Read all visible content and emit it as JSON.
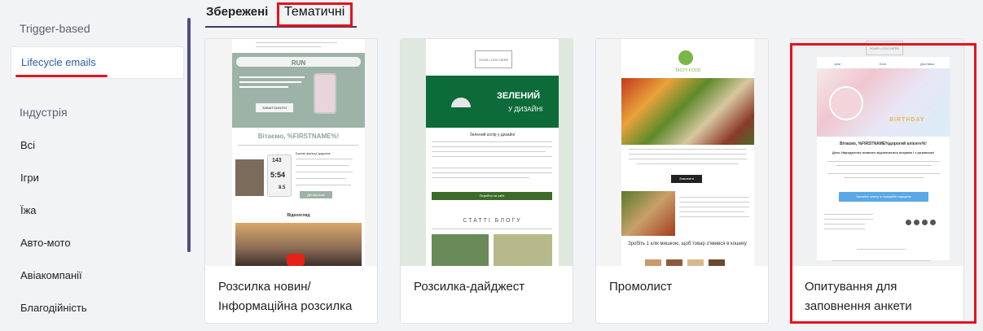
{
  "sidebar": {
    "trigger_label": "Trigger-based",
    "lifecycle_label": "Lifecycle emails",
    "industry_label": "Індустрія",
    "items": [
      "Всі",
      "Ігри",
      "Їжа",
      "Авто-мото",
      "Авіакомпанії",
      "Благодійність"
    ]
  },
  "tabs": {
    "saved": "Збережені",
    "thematic": "Тематичні"
  },
  "cards": [
    {
      "title": "Розсилка новин/ Інформаційна розсилка",
      "thumb": {
        "brand": "RUN",
        "heading": "Вітаємо, %FIRSTNAME%!",
        "button": "ЗАВАНТАЖИТИ",
        "stat1": "143",
        "stat2": "5:54",
        "stat3": "8.5",
        "section": "Відеоогляд",
        "feature_heading": "Базові функції додатка:",
        "more": "Детальніше"
      }
    },
    {
      "title": "Розсилка-дайджест",
      "thumb": {
        "logo": "YOUR LOGO HERE",
        "banner1": "ЗЕЛЕНИЙ",
        "banner2": "У ДИЗАЙНІ",
        "subtitle": "Зелений колір у дизайні",
        "button": "Перейти на сайт",
        "blog": "СТАТТІ БЛОГУ"
      }
    },
    {
      "title": "Промолист",
      "thumb": {
        "brand": "TASTY FOOD",
        "button": "Замовити",
        "tagline": "Зробіть 1 клік мишкою, щоб товар з'явився в кошику"
      }
    },
    {
      "title": "Опитування для заповнення анкети",
      "thumb": {
        "logo": "YOUR LOGO HERE",
        "nav": [
          "Ціни",
          "Блог",
          "Доставка"
        ],
        "cake_text": "BIRTHDAY",
        "heading": "Вітаємо, %FIRSTNAME%дорогий клієнте%!",
        "subheading": "День Народження повинен відзначатися яскраво і з розмахом!",
        "button": "Заповніть анкету та отримуйте подарунок"
      }
    }
  ],
  "colors": {
    "accent_red": "#e8111d",
    "link_blue": "#2b5ea7",
    "scroll": "#4a4e8a"
  }
}
